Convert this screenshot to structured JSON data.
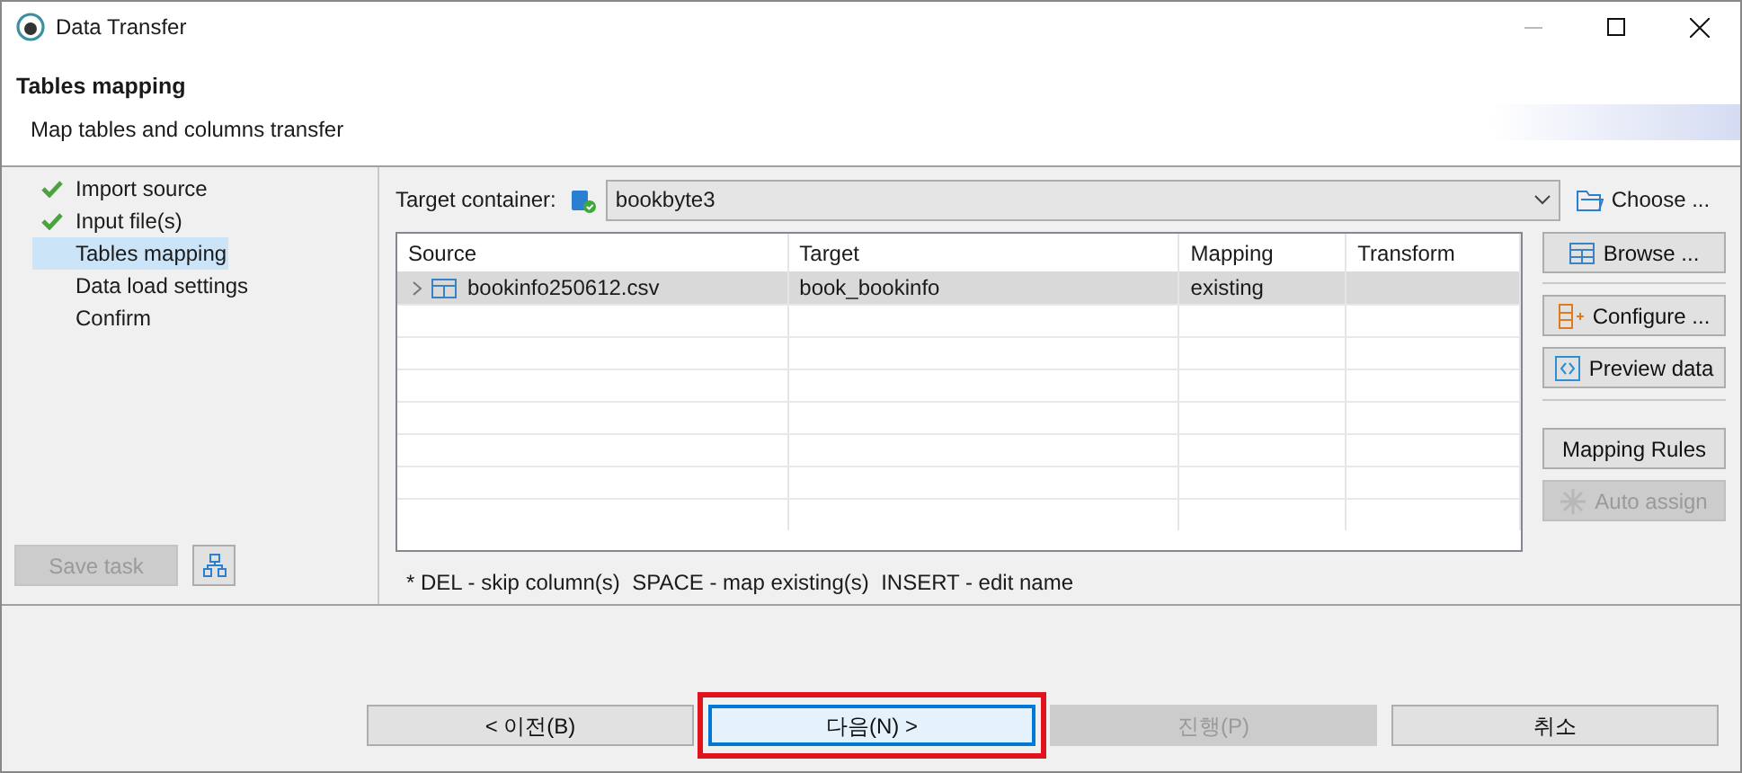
{
  "window": {
    "title": "Data Transfer"
  },
  "header": {
    "title": "Tables mapping",
    "subtitle": "Map tables and columns transfer"
  },
  "steps": [
    {
      "label": "Import source",
      "done": true,
      "selected": false
    },
    {
      "label": "Input file(s)",
      "done": true,
      "selected": false
    },
    {
      "label": "Tables mapping",
      "done": false,
      "selected": true
    },
    {
      "label": "Data load settings",
      "done": false,
      "selected": false
    },
    {
      "label": "Confirm",
      "done": false,
      "selected": false
    }
  ],
  "save_task": {
    "label": "Save task",
    "disabled": true
  },
  "target_container": {
    "label": "Target container:",
    "value": "bookbyte3"
  },
  "choose_button": "Choose ...",
  "table": {
    "columns": [
      "Source",
      "Target",
      "Mapping",
      "Transform"
    ],
    "rows": [
      {
        "source": "bookinfo250612.csv",
        "target": "book_bookinfo",
        "mapping": "existing",
        "transform": "",
        "selected": true
      }
    ]
  },
  "side_buttons": [
    {
      "label": "Browse ...",
      "kind": "table",
      "disabled": false
    },
    {
      "label": "Configure ...",
      "kind": "columns",
      "disabled": false
    },
    {
      "label": "Preview data",
      "kind": "preview",
      "disabled": false
    },
    {
      "label": "Mapping Rules",
      "kind": "plain",
      "disabled": false
    },
    {
      "label": "Auto assign",
      "kind": "assign",
      "disabled": true
    }
  ],
  "hint": "* DEL - skip column(s)  SPACE - map existing(s)  INSERT - edit name",
  "footer_buttons": [
    {
      "label": "< 이전(B)",
      "disabled": false,
      "focused": false,
      "highlighted": false
    },
    {
      "label": "다음(N) >",
      "disabled": false,
      "focused": true,
      "highlighted": true
    },
    {
      "label": "진행(P)",
      "disabled": true,
      "focused": false,
      "highlighted": false
    },
    {
      "label": "취소",
      "disabled": false,
      "focused": false,
      "highlighted": false
    }
  ]
}
